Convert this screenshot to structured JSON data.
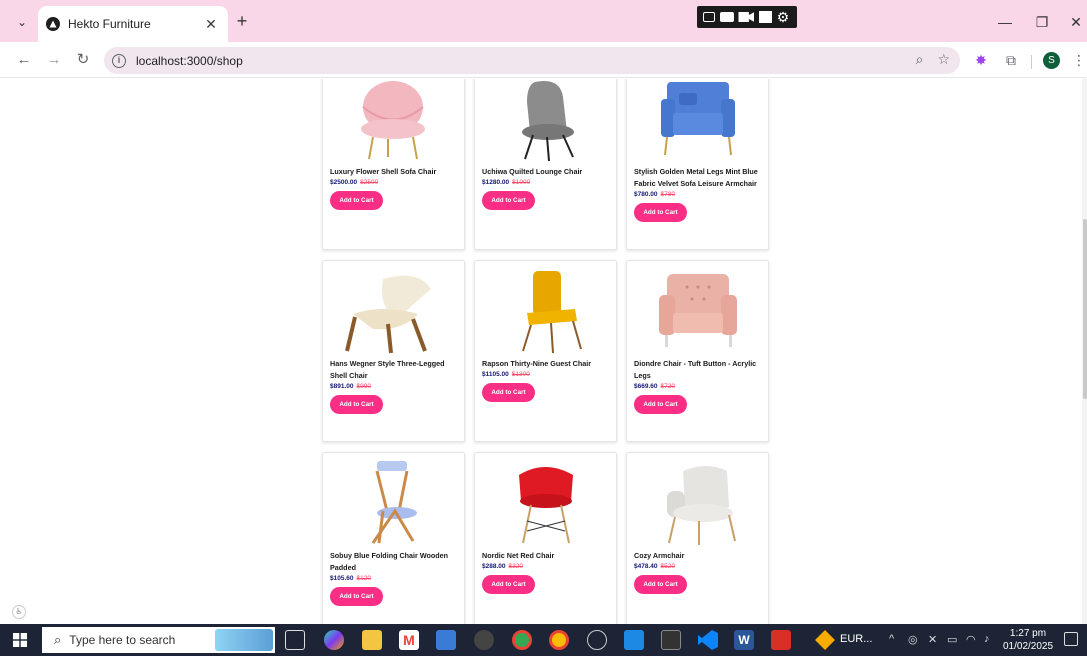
{
  "browser": {
    "tab_title": "Hekto Furniture",
    "tab_close": "✕",
    "new_tab": "+",
    "url": "localhost:3000/shop",
    "profile_initial": "S",
    "minimize": "—",
    "restore": "❐",
    "close": "✕"
  },
  "products": [
    {
      "name": "Luxury Flower Shell Sofa Chair",
      "price": "$2500.00",
      "old_price": "$2500",
      "button": "Add to Cart",
      "image": "pink-shell-chair"
    },
    {
      "name": "Uchiwa Quilted Lounge Chair",
      "price": "$1280.00",
      "old_price": "$1000",
      "button": "Add to Cart",
      "image": "grey-lounge-chair"
    },
    {
      "name": "Stylish Golden Metal Legs Mint Blue Fabric Velvet Sofa Leisure Armchair",
      "price": "$780.00",
      "old_price": "$780",
      "button": "Add to Cart",
      "image": "blue-velvet-armchair"
    },
    {
      "name": "Hans Wegner Style Three-Legged Shell Chair",
      "price": "$891.00",
      "old_price": "$990",
      "button": "Add to Cart",
      "image": "cream-shell-chair"
    },
    {
      "name": "Rapson Thirty-Nine Guest Chair",
      "price": "$1105.00",
      "old_price": "$1300",
      "button": "Add to Cart",
      "image": "yellow-guest-chair"
    },
    {
      "name": "Diondre Chair - Tuft Button - Acrylic Legs",
      "price": "$669.60",
      "old_price": "$720",
      "button": "Add to Cart",
      "image": "pink-tufted-armchair"
    },
    {
      "name": "Sobuy Blue Folding Chair Wooden Padded",
      "price": "$105.60",
      "old_price": "$120",
      "button": "Add to Cart",
      "image": "blue-folding-chair"
    },
    {
      "name": "Nordic Net Red Chair",
      "price": "$288.00",
      "old_price": "$320",
      "button": "Add to Cart",
      "image": "red-shell-chair"
    },
    {
      "name": "Cozy Armchair",
      "price": "$478.40",
      "old_price": "$520",
      "button": "Add to Cart",
      "image": "white-armchair"
    }
  ],
  "taskbar": {
    "search_placeholder": "Type here to search",
    "pinned_label": "EUR...",
    "time": "1:27 pm",
    "date": "01/02/2025"
  },
  "colors": {
    "accent": "#fb2e86",
    "price": "#151875",
    "old_price": "#f94a6a",
    "tabstrip": "#f9d6e8"
  }
}
